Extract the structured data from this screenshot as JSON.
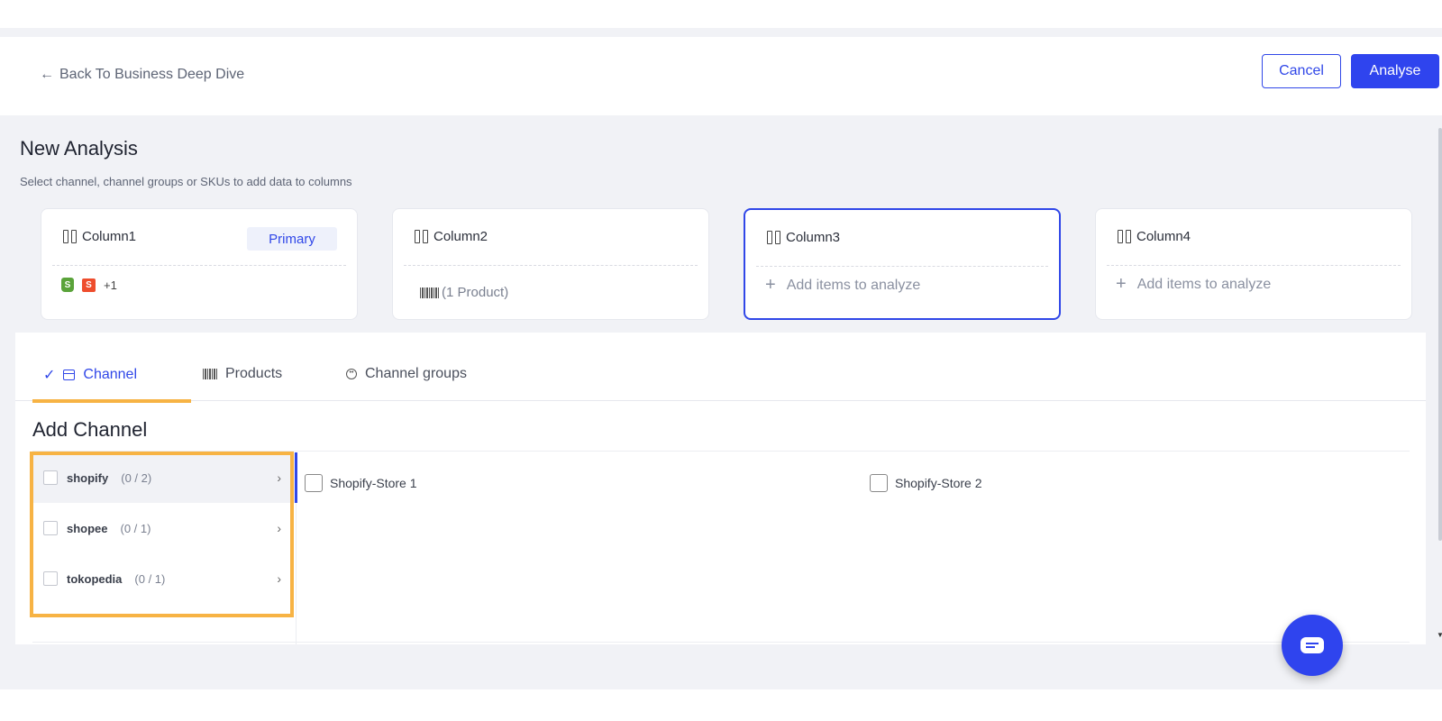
{
  "header": {
    "back_label": "Back To Business Deep Dive",
    "cancel_label": "Cancel",
    "analyse_label": "Analyse"
  },
  "page": {
    "title": "New Analysis",
    "subtitle": "Select channel, channel groups or SKUs to add data to columns"
  },
  "columns": [
    {
      "label": "Column1",
      "badge": "Primary",
      "extra_count": "+1"
    },
    {
      "label": "Column2",
      "products": "(1 Product)"
    },
    {
      "label": "Column3",
      "add_label": "Add items to analyze"
    },
    {
      "label": "Column4",
      "add_label": "Add items to analyze"
    }
  ],
  "tabs": [
    {
      "label": "Channel",
      "active": true
    },
    {
      "label": "Products",
      "active": false
    },
    {
      "label": "Channel groups",
      "active": false
    }
  ],
  "add_channel": {
    "title": "Add Channel",
    "channels": [
      {
        "name": "shopify",
        "count": "(0 / 2)"
      },
      {
        "name": "shopee",
        "count": "(0 / 1)"
      },
      {
        "name": "tokopedia",
        "count": "(0 / 1)"
      }
    ],
    "stores": [
      "Shopify-Store 1",
      "Shopify-Store 2"
    ]
  },
  "colors": {
    "accent": "#2f44ee",
    "highlight": "#f7b344"
  }
}
